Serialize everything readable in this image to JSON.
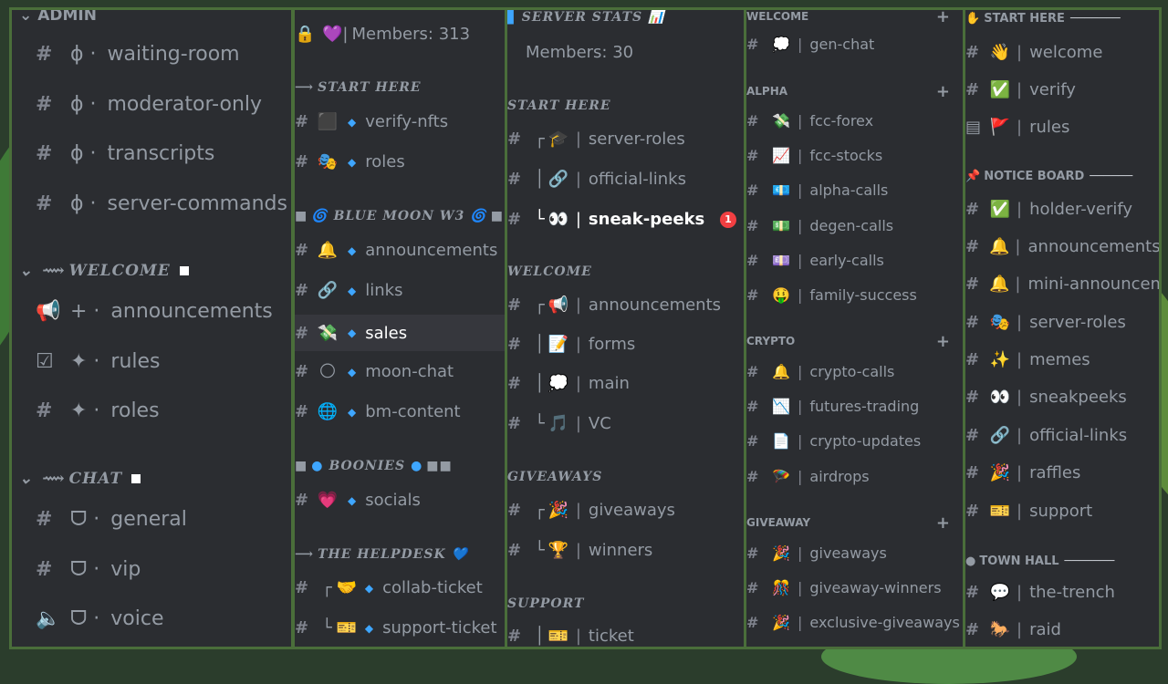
{
  "panel1": {
    "header": "ADMIN",
    "cat_welcome": "WELCOME",
    "cat_chat": "CHAT",
    "channels": [
      {
        "prefix": "ϕ ·",
        "name": "waiting-room"
      },
      {
        "prefix": "ϕ ·",
        "name": "moderator-only"
      },
      {
        "prefix": "ϕ ·",
        "name": "transcripts"
      },
      {
        "prefix": "ϕ ·",
        "name": "server-commands"
      },
      {
        "prefix": "+ ·",
        "name": "announcements"
      },
      {
        "prefix": "✦ ·",
        "name": "rules"
      },
      {
        "prefix": "✦ ·",
        "name": "roles"
      },
      {
        "prefix": "ᗜ ·",
        "name": "general"
      },
      {
        "prefix": "ᗜ ·",
        "name": "vip"
      },
      {
        "prefix": "ᗜ ·",
        "name": "voice"
      }
    ]
  },
  "panel2": {
    "members": "Members: 313",
    "cat_start": "START HERE",
    "cat_bluemoon": "BLUE MOON W3",
    "cat_boonies": "BOONIES",
    "cat_helpdesk": "THE HELPDESK",
    "channels": [
      {
        "emoji": "⬛",
        "name": "verify-nfts"
      },
      {
        "emoji": "🎭",
        "name": "roles"
      },
      {
        "emoji": "🔔",
        "name": "announcements"
      },
      {
        "emoji": "🔗",
        "name": "links"
      },
      {
        "emoji": "💸",
        "name": "sales"
      },
      {
        "emoji": "🌕",
        "name": "moon-chat"
      },
      {
        "emoji": "🌐",
        "name": "bm-content"
      },
      {
        "emoji": "💗",
        "name": "socials"
      },
      {
        "emoji": "🤝",
        "name": "collab-ticket"
      },
      {
        "emoji": "🎫",
        "name": "support-ticket"
      }
    ]
  },
  "panel3": {
    "header": "SERVER STATS",
    "members": "Members: 30",
    "cat_start": "START HERE",
    "cat_welcome": "WELCOME",
    "cat_giveaways": "GIVEAWAYS",
    "cat_support": "SUPPORT",
    "badge": "1",
    "channels": [
      {
        "emoji": "🎓",
        "name": "server-roles"
      },
      {
        "emoji": "🔗",
        "name": "official-links"
      },
      {
        "emoji": "👀",
        "name": "sneak-peeks"
      },
      {
        "emoji": "📢",
        "name": "announcements"
      },
      {
        "emoji": "📝",
        "name": "forms"
      },
      {
        "emoji": "💭",
        "name": "main"
      },
      {
        "emoji": "🎵",
        "name": "VC"
      },
      {
        "emoji": "🎉",
        "name": "giveaways"
      },
      {
        "emoji": "🏆",
        "name": "winners"
      },
      {
        "emoji": "🎫",
        "name": "ticket"
      }
    ]
  },
  "panel4": {
    "cat_welcome": "WELCOME",
    "cat_alpha": "ALPHA",
    "cat_crypto": "CRYPTO",
    "cat_giveaway": "GIVEAWAY",
    "channels": [
      {
        "emoji": "💭",
        "name": "gen-chat"
      },
      {
        "emoji": "💸",
        "name": "fcc-forex"
      },
      {
        "emoji": "📈",
        "name": "fcc-stocks"
      },
      {
        "emoji": "💶",
        "name": "alpha-calls"
      },
      {
        "emoji": "💵",
        "name": "degen-calls"
      },
      {
        "emoji": "💷",
        "name": "early-calls"
      },
      {
        "emoji": "🤑",
        "name": "family-success"
      },
      {
        "emoji": "🔔",
        "name": "crypto-calls"
      },
      {
        "emoji": "📉",
        "name": "futures-trading"
      },
      {
        "emoji": "📄",
        "name": "crypto-updates"
      },
      {
        "emoji": "🪂",
        "name": "airdrops"
      },
      {
        "emoji": "🎉",
        "name": "giveaways"
      },
      {
        "emoji": "🎊",
        "name": "giveaway-winners"
      },
      {
        "emoji": "🎉",
        "name": "exclusive-giveaways"
      }
    ]
  },
  "panel5": {
    "cat_start": "START HERE",
    "cat_notice": "NOTICE BOARD",
    "cat_townhall": "TOWN HALL",
    "channels": [
      {
        "emoji": "👋",
        "name": "welcome"
      },
      {
        "emoji": "✅",
        "name": "verify"
      },
      {
        "emoji": "🚩",
        "name": "rules"
      },
      {
        "emoji": "✅",
        "name": "holder-verify"
      },
      {
        "emoji": "🔔",
        "name": "announcements"
      },
      {
        "emoji": "🔔",
        "name": "mini-announcements"
      },
      {
        "emoji": "🎭",
        "name": "server-roles"
      },
      {
        "emoji": "✨",
        "name": "memes"
      },
      {
        "emoji": "👀",
        "name": "sneakpeeks"
      },
      {
        "emoji": "🔗",
        "name": "official-links"
      },
      {
        "emoji": "🎉",
        "name": "raffles"
      },
      {
        "emoji": "🎫",
        "name": "support"
      },
      {
        "emoji": "💬",
        "name": "the-trench"
      },
      {
        "emoji": "🐎",
        "name": "raid"
      }
    ]
  },
  "colors": {
    "panel_bg": "#2b2d31",
    "border": "#4a6e3a",
    "text": "#949ba4",
    "diamond": "#3ea6ff",
    "badge": "#f23f42"
  }
}
